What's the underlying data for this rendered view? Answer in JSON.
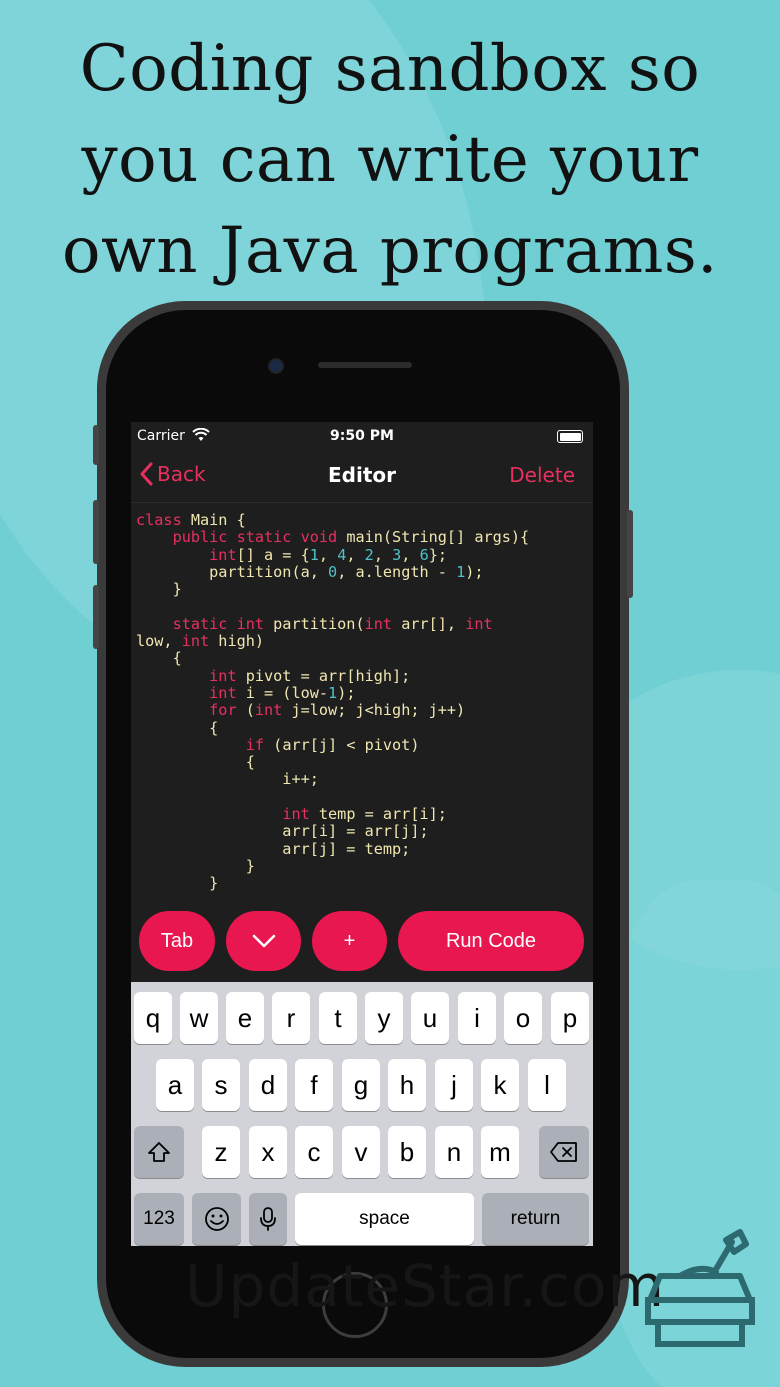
{
  "headline": [
    "Coding sandbox so",
    "you can write your",
    "own Java programs."
  ],
  "status": {
    "carrier": "Carrier",
    "time": "9:50 PM"
  },
  "nav": {
    "back": "Back",
    "title": "Editor",
    "delete": "Delete"
  },
  "toolbar": {
    "tab": "Tab",
    "chevron": "∨",
    "plus": "+",
    "run": "Run Code"
  },
  "keyboard": {
    "row1": [
      "q",
      "w",
      "e",
      "r",
      "t",
      "y",
      "u",
      "i",
      "o",
      "p"
    ],
    "row2": [
      "a",
      "s",
      "d",
      "f",
      "g",
      "h",
      "j",
      "k",
      "l"
    ],
    "row3": [
      "z",
      "x",
      "c",
      "v",
      "b",
      "n",
      "m"
    ],
    "numbers": "123",
    "space": "space",
    "return": "return"
  },
  "watermark": "UpdateStar.com",
  "colors": {
    "accent": "#e8174f",
    "background": "#6fcfd3",
    "code_text": "#f0e6b0",
    "keyword": "#e8305f",
    "number": "#4fc1c8"
  }
}
